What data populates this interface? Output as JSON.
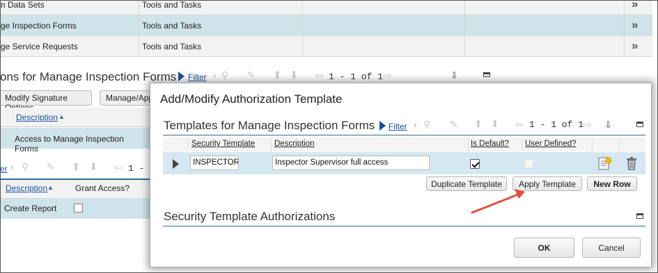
{
  "background": {
    "rows": [
      {
        "name": "n Data Sets",
        "category": "Tools and Tasks"
      },
      {
        "name": "ge Inspection Forms",
        "category": "Tools and Tasks"
      },
      {
        "name": "ge Service Requests",
        "category": "Tools and Tasks"
      }
    ],
    "section_title": "ons for Manage Inspection Forms",
    "filter_label": "Filter",
    "pager": "1 - 1 of 1",
    "modify_signature_button": "Modify Signature Options",
    "manage_button": "Manage/App",
    "description_header": "Description",
    "access_row": "Access to Manage Inspection Forms",
    "filter2_label": "er",
    "pager2": "1 -",
    "description_header2": "Description",
    "grant_access_header": "Grant Access?",
    "create_report": "Create Report"
  },
  "modal": {
    "title": "Add/Modify Authorization Template",
    "templates_title": "Templates for Manage Inspection Forms",
    "filter_label": "Filter",
    "pager": "1 - 1 of 1",
    "columns": {
      "security_template": "Security Template",
      "description": "Description",
      "is_default": "Is Default?",
      "user_defined": "User Defined?"
    },
    "row": {
      "security_template": "INSPECTORS",
      "description": "Inspector Supervisor full access",
      "is_default": true,
      "user_defined": false
    },
    "buttons": {
      "duplicate": "Duplicate Template",
      "apply": "Apply Template",
      "new_row": "New Row",
      "ok": "OK",
      "cancel": "Cancel"
    },
    "authorizations_title": "Security Template Authorizations"
  },
  "colors": {
    "accent": "#2d6e8e",
    "selected_row": "#d5e8f2",
    "link": "#1a4f9c",
    "annotation_arrow": "#e0503c"
  }
}
